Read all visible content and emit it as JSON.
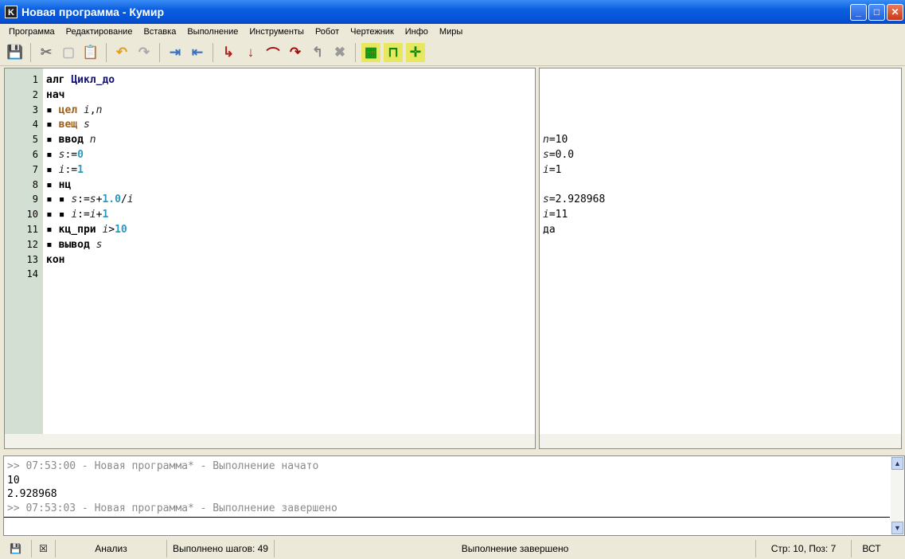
{
  "window": {
    "title": "Новая программа - Кумир",
    "icon_letter": "K"
  },
  "menu": [
    "Программа",
    "Редактирование",
    "Вставка",
    "Выполнение",
    "Инструменты",
    "Робот",
    "Чертежник",
    "Инфо",
    "Миры"
  ],
  "toolbar": [
    {
      "icon": "save-icon",
      "glyph": "💾"
    },
    {
      "sep": true
    },
    {
      "icon": "cut-icon",
      "glyph": "✂"
    },
    {
      "icon": "copy-icon",
      "glyph": "▢"
    },
    {
      "icon": "paste-icon",
      "glyph": "📋"
    },
    {
      "sep": true
    },
    {
      "icon": "undo-icon",
      "glyph": "↶"
    },
    {
      "icon": "redo-icon",
      "glyph": "↷"
    },
    {
      "sep": true
    },
    {
      "icon": "indent-icon",
      "glyph": "⇥"
    },
    {
      "icon": "unindent-icon",
      "glyph": "⇤"
    },
    {
      "sep": true
    },
    {
      "icon": "run-icon",
      "glyph": "↳"
    },
    {
      "icon": "run-step-icon",
      "glyph": "↓"
    },
    {
      "icon": "step-over-icon",
      "glyph": "⌒"
    },
    {
      "icon": "step-into-icon",
      "glyph": "↷"
    },
    {
      "icon": "step-out-icon",
      "glyph": "↰"
    },
    {
      "icon": "stop-icon",
      "glyph": "✖"
    },
    {
      "sep": true
    },
    {
      "icon": "robot-field-icon",
      "glyph": "▦"
    },
    {
      "icon": "robot-icon",
      "glyph": "⊓"
    },
    {
      "icon": "drawer-icon",
      "glyph": "✛"
    }
  ],
  "editor": {
    "lines": [
      [
        [
          "kw",
          "алг "
        ],
        [
          "nm",
          "Цикл_до"
        ]
      ],
      [
        [
          "kw",
          "нач"
        ]
      ],
      [
        [
          "dot",
          "▪ "
        ],
        [
          "ty",
          "цел "
        ],
        [
          "va",
          "i"
        ],
        [
          "op",
          ","
        ],
        [
          "va",
          "n"
        ]
      ],
      [
        [
          "dot",
          "▪ "
        ],
        [
          "ty",
          "вещ "
        ],
        [
          "va",
          "s"
        ]
      ],
      [
        [
          "dot",
          "▪ "
        ],
        [
          "kw",
          "ввод "
        ],
        [
          "va",
          "n"
        ]
      ],
      [
        [
          "dot",
          "▪ "
        ],
        [
          "va",
          "s"
        ],
        [
          "op",
          ":="
        ],
        [
          "nu",
          "0"
        ]
      ],
      [
        [
          "dot",
          "▪ "
        ],
        [
          "va",
          "i"
        ],
        [
          "op",
          ":="
        ],
        [
          "nu",
          "1"
        ]
      ],
      [
        [
          "dot",
          "▪ "
        ],
        [
          "kw",
          "нц"
        ]
      ],
      [
        [
          "dot",
          "▪ ▪ "
        ],
        [
          "va",
          "s"
        ],
        [
          "op",
          ":="
        ],
        [
          "va",
          "s"
        ],
        [
          "op",
          "+"
        ],
        [
          "nu",
          "1.0"
        ],
        [
          "op",
          "/"
        ],
        [
          "va",
          "i"
        ]
      ],
      [
        [
          "dot",
          "▪ ▪ "
        ],
        [
          "va",
          "i"
        ],
        [
          "op",
          ":="
        ],
        [
          "va",
          "i"
        ],
        [
          "op",
          "+"
        ],
        [
          "nu",
          "1"
        ]
      ],
      [
        [
          "dot",
          "▪ "
        ],
        [
          "kw",
          "кц_при "
        ],
        [
          "va",
          "i"
        ],
        [
          "op",
          ">"
        ],
        [
          "nu",
          "10"
        ]
      ],
      [
        [
          "dot",
          "▪ "
        ],
        [
          "kw",
          "вывод "
        ],
        [
          "va",
          "s"
        ]
      ],
      [
        [
          "kw",
          "кон"
        ]
      ],
      []
    ]
  },
  "variables": {
    "lines": [
      {
        "line": 5,
        "name": "n",
        "value": "=10"
      },
      {
        "line": 6,
        "name": "s",
        "value": "=0.0"
      },
      {
        "line": 7,
        "name": "i",
        "value": "=1"
      },
      {
        "line": 9,
        "name": "s",
        "value": "=2.928968"
      },
      {
        "line": 10,
        "name": "i",
        "value": "=11"
      },
      {
        "line": 11,
        "name": "",
        "value": "да"
      }
    ]
  },
  "console": {
    "lines": [
      {
        "type": "log",
        "text": ">> 07:53:00 - Новая программа* - Выполнение начато"
      },
      {
        "type": "out",
        "text": "10"
      },
      {
        "type": "out",
        "text": "2.928968"
      },
      {
        "type": "log",
        "text": ">> 07:53:03 - Новая программа* - Выполнение завершено"
      }
    ]
  },
  "status": {
    "mode": "Анализ",
    "steps": "Выполнено шагов: 49",
    "message": "Выполнение завершено",
    "position": "Стр: 10, Поз: 7",
    "insert": "ВСТ"
  }
}
